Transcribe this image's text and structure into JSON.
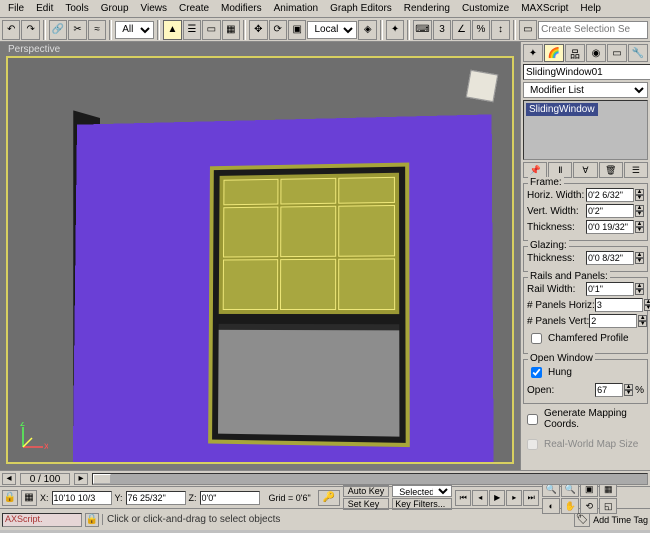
{
  "menus": [
    "File",
    "Edit",
    "Tools",
    "Group",
    "Views",
    "Create",
    "Modifiers",
    "Animation",
    "Graph Editors",
    "Rendering",
    "Customize",
    "MAXScript",
    "Help"
  ],
  "toolbar": {
    "selection_filter": "All",
    "ref_coord": "Local",
    "create_selection_label": "Create Selection Se"
  },
  "viewport": {
    "label": "Perspective"
  },
  "cmdpanel": {
    "object_name": "SlidingWindow01",
    "modifier_list_label": "Modifier List",
    "stack_item": "SlidingWindow",
    "frame": {
      "title": "Frame:",
      "horiz_width_label": "Horiz. Width:",
      "horiz_width": "0'2 6/32\"",
      "vert_width_label": "Vert. Width:",
      "vert_width": "0'2\"",
      "thickness_label": "Thickness:",
      "thickness": "0'0 19/32\""
    },
    "glazing": {
      "title": "Glazing:",
      "thickness_label": "Thickness:",
      "thickness": "0'0 8/32\""
    },
    "rails": {
      "title": "Rails and Panels:",
      "rail_width_label": "Rail Width:",
      "rail_width": "0'1\"",
      "panels_h_label": "# Panels Horiz:",
      "panels_h": "3",
      "panels_v_label": "# Panels Vert:",
      "panels_v": "2",
      "chamfered_label": "Chamfered Profile",
      "chamfered": false
    },
    "openwin": {
      "title": "Open Window",
      "hung_label": "Hung",
      "hung": true,
      "open_label": "Open:",
      "open": "67",
      "open_suffix": "%"
    },
    "mapcoords_label": "Generate Mapping Coords.",
    "mapcoords": false,
    "realworld_label": "Real-World Map Size",
    "realworld": false
  },
  "time": {
    "frame_display": "0 / 100"
  },
  "status": {
    "x_label": "X:",
    "x": "10'10 10/3",
    "y_label": "Y:",
    "y": "76 25/32\"",
    "z_label": "Z:",
    "z": "0'0\"",
    "grid_label": "Grid = 0'6\"",
    "autokey_label": "Auto Key",
    "setkey_label": "Set Key",
    "key_sel": "Selected",
    "keyfilters_label": "Key Filters..."
  },
  "status2": {
    "script": "AXScript.",
    "prompt": "Click or click-and-drag to select objects",
    "addtime_label": "Add Time Tag"
  }
}
